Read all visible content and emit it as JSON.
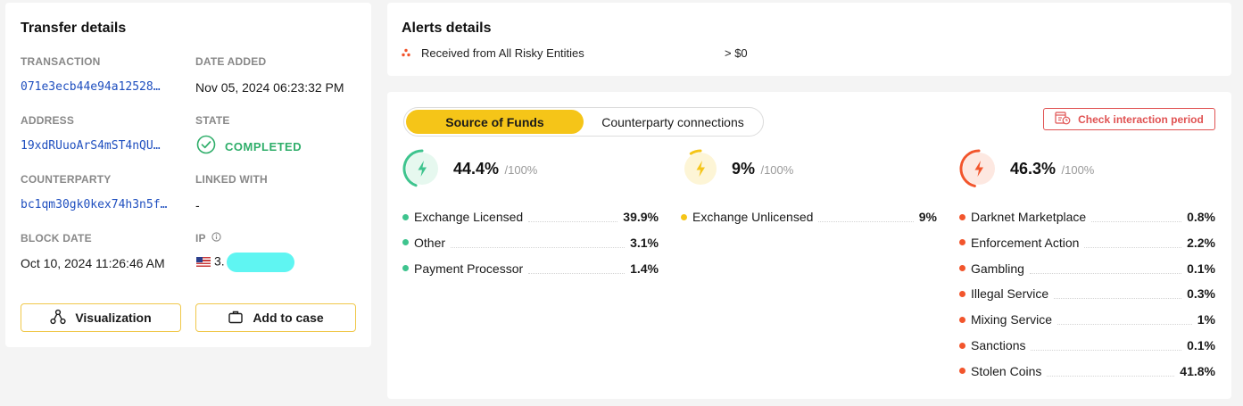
{
  "transfer": {
    "title": "Transfer details",
    "transaction_label": "TRANSACTION",
    "transaction_value": "071e3ecb44e94a12528…",
    "date_added_label": "DATE ADDED",
    "date_added_value": "Nov 05, 2024 06:23:32 PM",
    "address_label": "ADDRESS",
    "address_value": "19xdRUuoArS4mST4nQU…",
    "state_label": "STATE",
    "state_value": "COMPLETED",
    "counterparty_label": "COUNTERPARTY",
    "counterparty_value": "bc1qm30gk0kex74h3n5f…",
    "linked_label": "LINKED WITH",
    "linked_value": "-",
    "block_date_label": "BLOCK DATE",
    "block_date_value": "Oct 10, 2024 11:26:46 AM",
    "ip_label": "IP",
    "ip_value": "3.",
    "visualization_button": "Visualization",
    "add_to_case_button": "Add to case"
  },
  "alerts": {
    "title": "Alerts details",
    "rule": "Received from All Risky Entities",
    "threshold": "> $0"
  },
  "funds": {
    "tab_active": "Source of Funds",
    "tab_inactive": "Counterparty connections",
    "check_button": "Check interaction period",
    "out_of": "/100%",
    "groups": [
      {
        "percent": "44.4%",
        "fraction": 0.444,
        "color": "#3ec48e",
        "rows": [
          {
            "label": "Exchange Licensed",
            "value": "39.9%"
          },
          {
            "label": "Other",
            "value": "3.1%"
          },
          {
            "label": "Payment Processor",
            "value": "1.4%"
          }
        ]
      },
      {
        "percent": "9%",
        "fraction": 0.09,
        "color": "#f5c518",
        "rows": [
          {
            "label": "Exchange Unlicensed",
            "value": "9%"
          }
        ]
      },
      {
        "percent": "46.3%",
        "fraction": 0.463,
        "color": "#f2552c",
        "rows": [
          {
            "label": "Darknet Marketplace",
            "value": "0.8%"
          },
          {
            "label": "Enforcement Action",
            "value": "2.2%"
          },
          {
            "label": "Gambling",
            "value": "0.1%"
          },
          {
            "label": "Illegal Service",
            "value": "0.3%"
          },
          {
            "label": "Mixing Service",
            "value": "1%"
          },
          {
            "label": "Sanctions",
            "value": "0.1%"
          },
          {
            "label": "Stolen Coins",
            "value": "41.8%"
          }
        ]
      }
    ]
  }
}
